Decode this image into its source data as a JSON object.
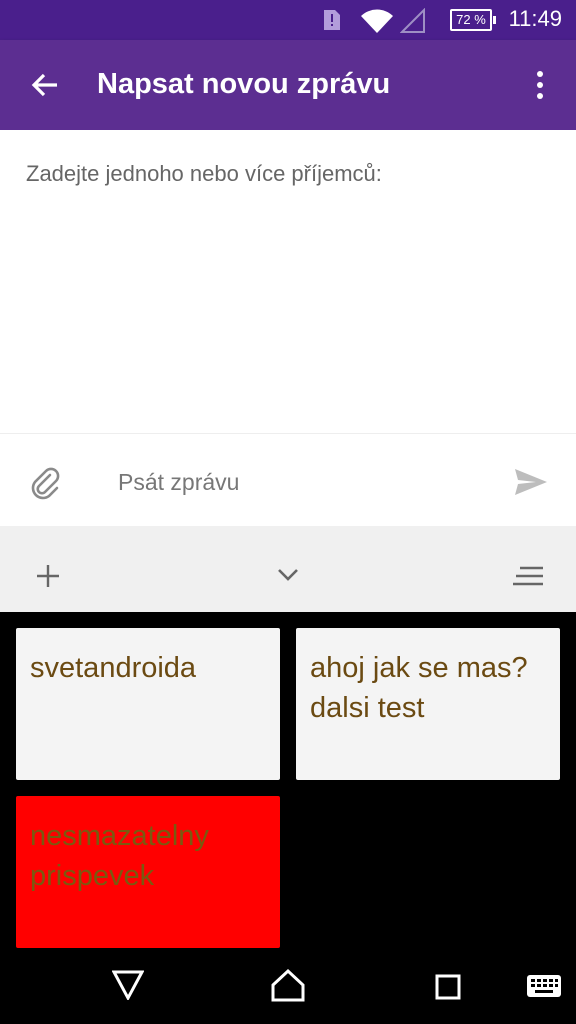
{
  "status": {
    "battery": "72 %",
    "time": "11:49"
  },
  "appbar": {
    "title": "Napsat novou zprávu"
  },
  "recipients": {
    "placeholder": "Zadejte jednoho nebo více příjemců:"
  },
  "composer": {
    "placeholder": "Psát zprávu"
  },
  "clipboard": {
    "items": [
      {
        "text": "svetandroida"
      },
      {
        "text": "ahoj jak se mas?dalsi test"
      },
      {
        "text": "nesmazatelny prispevek"
      }
    ]
  },
  "colors": {
    "statusbar": "#4a1f8c",
    "appbar": "#5c2e91",
    "clip_text": "#6b4a12",
    "clip_pinned": "#ff0000"
  }
}
